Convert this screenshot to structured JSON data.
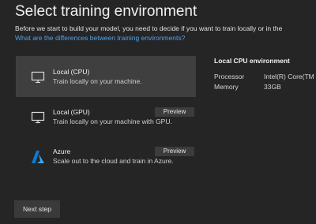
{
  "header": {
    "title": "Select training environment",
    "description": "Before we start to build your model, you need to decide if you want to train locally or in the",
    "link_text": "What are the differences between training environments?"
  },
  "options": [
    {
      "title": "Local (CPU)",
      "subtitle": "Train locally on your machine.",
      "badge": "",
      "icon": "monitor-icon",
      "selected": true
    },
    {
      "title": "Local (GPU)",
      "subtitle": "Train locally on your machine with GPU.",
      "badge": "Preview",
      "icon": "monitor-icon",
      "selected": false
    },
    {
      "title": "Azure",
      "subtitle": "Scale out to the cloud and train in Azure.",
      "badge": "Preview",
      "icon": "azure-icon",
      "selected": false
    }
  ],
  "details": {
    "heading": "Local CPU environment",
    "specs": [
      {
        "label": "Processor",
        "value": "Intel(R) Core(TM"
      },
      {
        "label": "Memory",
        "value": "33GB"
      }
    ]
  },
  "footer": {
    "next_label": "Next step"
  },
  "colors": {
    "background": "#252526",
    "selected": "#3f3f40",
    "link": "#4fa3e8",
    "azure_blue": "#0a7ad4"
  }
}
